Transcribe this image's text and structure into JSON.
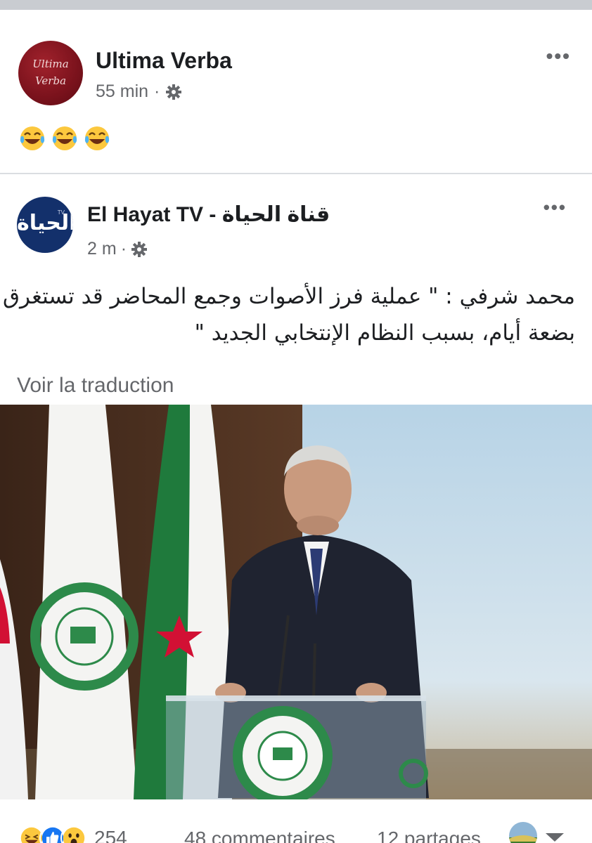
{
  "outer_post": {
    "author": "Ultima Verba",
    "avatar_text": [
      "Ultima",
      "Verba"
    ],
    "timestamp": "55 min",
    "meta_separator": "·",
    "privacy_icon": "gear-icon",
    "more_label": "•••",
    "body_emojis": [
      "😂",
      "😂",
      "😂"
    ]
  },
  "inner_post": {
    "author": "El Hayat TV - قناة الحياة",
    "avatar_text": "الحياة",
    "avatar_tag": "TV",
    "timestamp": "2 m",
    "meta_separator": "·",
    "privacy_icon": "gear-icon",
    "more_label": "•••",
    "text_lines": [
      "محمد شرفي : \" عملية فرز الأصوات وجمع المحاضر قد تستغرق",
      "بضعة أيام، بسبب النظام الإنتخابي الجديد \""
    ],
    "see_translation": "Voir la traduction"
  },
  "stats": {
    "reactions": [
      "laugh",
      "like",
      "wow"
    ],
    "reaction_count": "254",
    "comments": "48 commentaires",
    "shares": "12 partages"
  },
  "colors": {
    "secondary_text": "#65676b",
    "primary_text": "#1c1e21",
    "like_blue": "#1877f2",
    "emoji_yellow": "#fcc83e",
    "flag_green": "#1f7a3c",
    "flag_red": "#d21034"
  }
}
